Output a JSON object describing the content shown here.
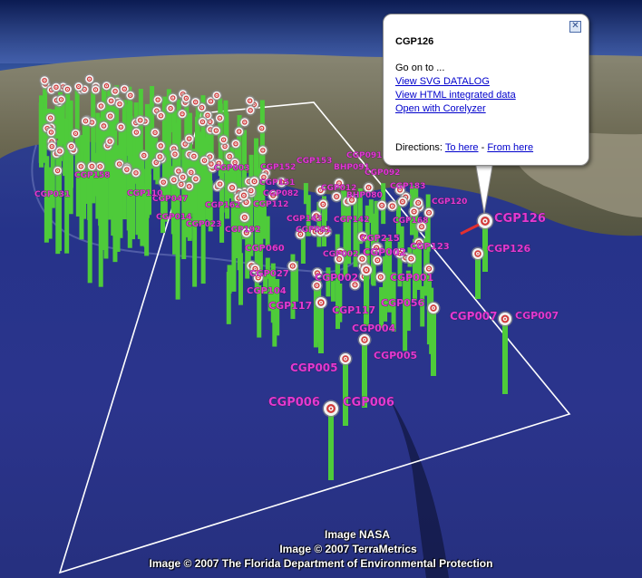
{
  "balloon": {
    "title": "CGP126",
    "go_on": "Go on to ...",
    "links": [
      "View SVG DATALOG",
      "View HTML integrated data",
      "Open with Corelyzer"
    ],
    "directions_label": "Directions:",
    "to_here": "To here",
    "separator": "-",
    "from_here": "From here",
    "close_symbol": "✕"
  },
  "attribution": [
    "Image NASA",
    "Image © 2007 TerraMetrics",
    "Image © 2007 The Florida Department of Environmental Protection"
  ],
  "colors": {
    "core_bar": "#4ecb3a",
    "label": "#e23ad3",
    "boundary": "#ffffff",
    "selected_line": "#e23030"
  },
  "labels": [
    {
      "text": "CGP126",
      "size": "large"
    },
    {
      "text": "CGP126",
      "size": "medium"
    },
    {
      "text": "CGP007",
      "size": "large"
    },
    {
      "text": "CGP007",
      "size": "medium"
    },
    {
      "text": "CGP006",
      "size": "large"
    },
    {
      "text": "CGP006",
      "size": "large"
    },
    {
      "text": "CGP005",
      "size": "large"
    },
    {
      "text": "CGP005",
      "size": "medium"
    },
    {
      "text": "CGP004",
      "size": "medium"
    },
    {
      "text": "CGP117",
      "size": "medium"
    },
    {
      "text": "CGP117",
      "size": "medium"
    },
    {
      "text": "CGP056",
      "size": "medium"
    },
    {
      "text": "CGP001",
      "size": "medium"
    },
    {
      "text": "CGP002",
      "size": "medium"
    },
    {
      "text": "CGP002",
      "size": "medium"
    },
    {
      "text": "CGP002",
      "size": "small"
    },
    {
      "text": "CGP104",
      "size": "small"
    },
    {
      "text": "CGP027",
      "size": "small"
    },
    {
      "text": "CGP060",
      "size": "small"
    },
    {
      "text": "CGP123",
      "size": "small"
    },
    {
      "text": "CGP215",
      "size": "small"
    },
    {
      "text": "CGP168",
      "size": "small"
    },
    {
      "text": "CGP120",
      "size": "small"
    },
    {
      "text": "CGP183",
      "size": "small"
    },
    {
      "text": "CGP092",
      "size": "small"
    },
    {
      "text": "CGP091",
      "size": "small"
    },
    {
      "text": "BHP091",
      "size": "small"
    },
    {
      "text": "BHP080",
      "size": "small"
    },
    {
      "text": "CGP012",
      "size": "small"
    },
    {
      "text": "CGP143",
      "size": "small"
    },
    {
      "text": "CGP142",
      "size": "small"
    },
    {
      "text": "CGP192",
      "size": "small"
    },
    {
      "text": "CGP082",
      "size": "small"
    },
    {
      "text": "CGP151",
      "size": "small"
    },
    {
      "text": "CGP152",
      "size": "small"
    },
    {
      "text": "CGP153",
      "size": "small"
    },
    {
      "text": "CGP162",
      "size": "small"
    },
    {
      "text": "CGP112",
      "size": "small"
    },
    {
      "text": "CGP014",
      "size": "small"
    },
    {
      "text": "CGP023",
      "size": "small"
    },
    {
      "text": "CGP003",
      "size": "small"
    },
    {
      "text": "CGP047",
      "size": "small"
    },
    {
      "text": "CGP110",
      "size": "small"
    },
    {
      "text": "CGP031",
      "size": "small"
    },
    {
      "text": "CGP158",
      "size": "small"
    },
    {
      "text": "CGP061",
      "size": "small"
    }
  ]
}
